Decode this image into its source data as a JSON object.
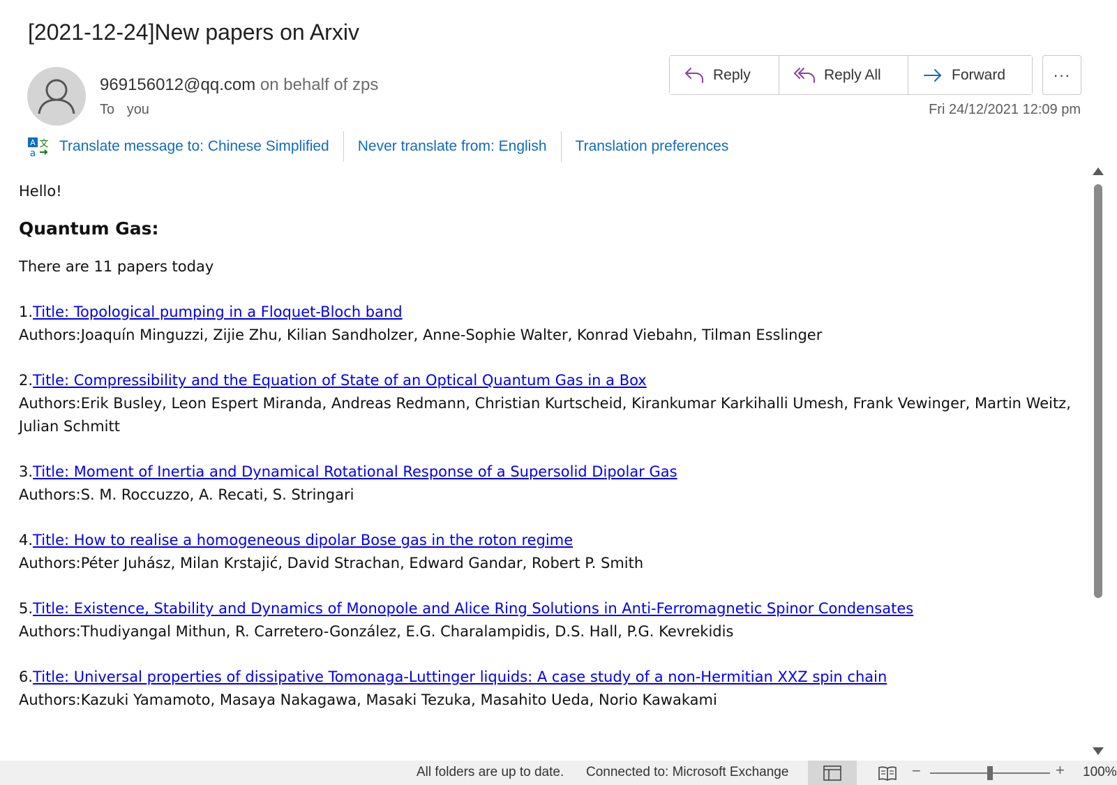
{
  "message": {
    "subject": "[2021-12-24]New papers on Arxiv",
    "sender_email": "969156012@qq.com",
    "sender_behalf": "on behalf of zps",
    "to_label": "To",
    "to_value": "you",
    "date": "Fri 24/12/2021 12:09 pm"
  },
  "actions": {
    "reply": "Reply",
    "reply_all": "Reply All",
    "forward": "Forward",
    "more": "···"
  },
  "translation": {
    "translate_to": "Translate message to: Chinese Simplified",
    "never_translate": "Never translate from: English",
    "preferences": "Translation preferences"
  },
  "body": {
    "greeting": "Hello!",
    "section_title": "Quantum Gas:",
    "count_text": "There are 11 papers today",
    "papers": [
      {
        "num": "1.",
        "title": "Title: Topological pumping in a Floquet-Bloch band",
        "authors": "Authors:Joaquín Minguzzi, Zijie Zhu, Kilian Sandholzer, Anne-Sophie Walter, Konrad Viebahn, Tilman Esslinger"
      },
      {
        "num": "2.",
        "title": "Title: Compressibility and the Equation of State of an Optical Quantum Gas in a Box",
        "authors": "Authors:Erik Busley, Leon Espert Miranda, Andreas Redmann, Christian Kurtscheid, Kirankumar Karkihalli Umesh, Frank Vewinger, Martin Weitz, Julian Schmitt"
      },
      {
        "num": "3.",
        "title": "Title: Moment of Inertia and Dynamical Rotational Response of a Supersolid Dipolar Gas",
        "authors": "Authors:S. M. Roccuzzo, A. Recati, S. Stringari"
      },
      {
        "num": "4.",
        "title": "Title: How to realise a homogeneous dipolar Bose gas in the roton regime",
        "authors": "Authors:Péter Juhász, Milan Krstajić, David Strachan, Edward Gandar, Robert P. Smith"
      },
      {
        "num": "5.",
        "title": "Title: Existence, Stability and Dynamics of Monopole and Alice Ring Solutions in Anti-Ferromagnetic Spinor Condensates",
        "authors": "Authors:Thudiyangal Mithun, R. Carretero-González, E.G. Charalampidis, D.S. Hall, P.G. Kevrekidis"
      },
      {
        "num": "6.",
        "title": "Title: Universal properties of dissipative Tomonaga-Luttinger liquids: A case study of a non-Hermitian XXZ spin chain",
        "authors": "Authors:Kazuki Yamamoto, Masaya Nakagawa, Masaki Tezuka, Masahito Ueda, Norio Kawakami"
      }
    ]
  },
  "status": {
    "sync": "All folders are up to date.",
    "connection": "Connected to: Microsoft Exchange",
    "zoom_level": "100%",
    "zoom_minus": "−",
    "zoom_plus": "+"
  },
  "icons": {
    "avatar": "person-icon",
    "reply": "reply-arrow-icon",
    "reply_all": "reply-all-arrow-icon",
    "forward": "forward-arrow-icon",
    "translate": "translate-icon",
    "normal_view": "normal-view-icon",
    "reading_view": "reading-view-icon"
  },
  "colors": {
    "link": "#0000ee",
    "translate_link": "#0f6cbd",
    "reply_icon": "#8b3fa8",
    "forward_icon": "#0f6cbd"
  }
}
